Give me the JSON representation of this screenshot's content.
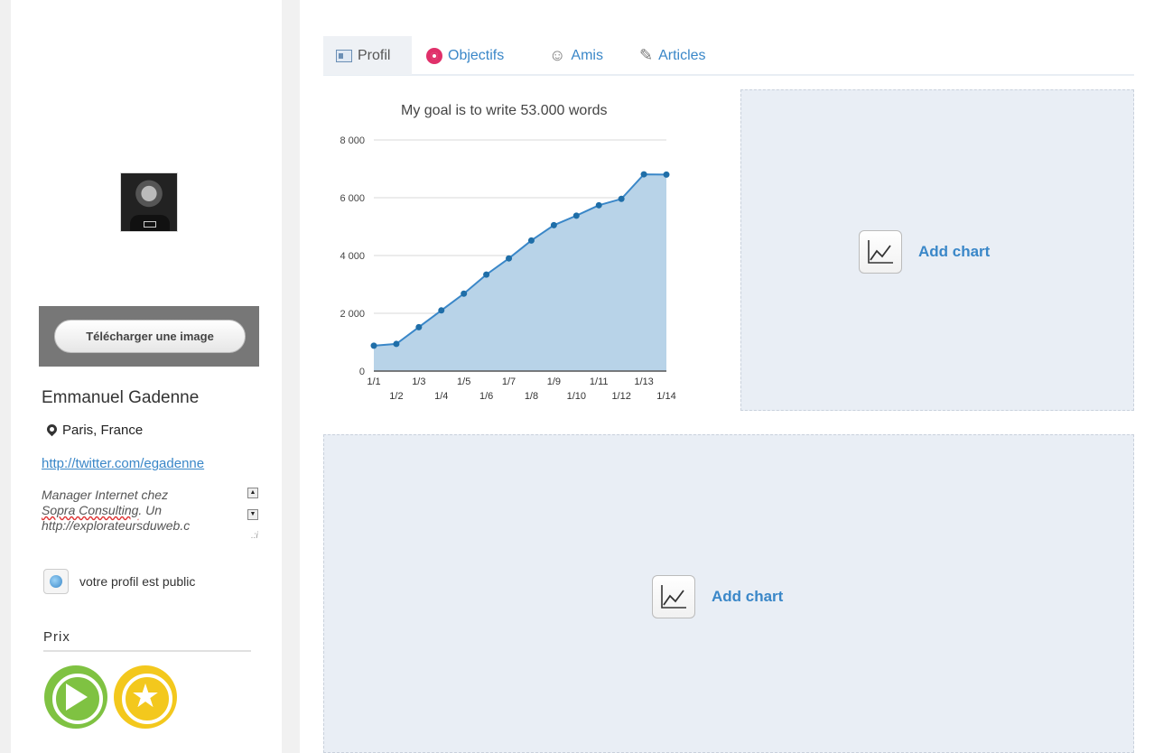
{
  "profile": {
    "upload_label": "Télécharger une image",
    "name": "Emmanuel Gadenne",
    "location": "Paris, France",
    "link": "http://twitter.com/egadenne",
    "bio": {
      "line1": "Manager Internet chez",
      "misspelled": "Sopra Consulting",
      "line2_rest": ". Un",
      "line3": "http://explorateursduweb.c"
    },
    "visibility": "votre profil est public",
    "awards_title": "Prix"
  },
  "tabs": [
    {
      "label": "Profil",
      "icon": "id-card-icon"
    },
    {
      "label": "Objectifs",
      "icon": "target-icon"
    },
    {
      "label": "Amis",
      "icon": "people-icon"
    },
    {
      "label": "Articles",
      "icon": "pencil-icon"
    }
  ],
  "add_chart_label": "Add chart",
  "colors": {
    "accent": "#3a87c8",
    "area_fill": "#b8d3e8",
    "line": "#3a87c8",
    "panel": "#e9eef5",
    "badge_green": "#7fc242",
    "badge_yellow": "#f3c81d"
  },
  "chart_data": {
    "type": "area",
    "title": "My goal is to write 53.000 words",
    "x": [
      "1/1",
      "1/2",
      "1/3",
      "1/4",
      "1/5",
      "1/6",
      "1/7",
      "1/8",
      "1/9",
      "1/10",
      "1/11",
      "1/12",
      "1/13",
      "1/14"
    ],
    "values": [
      880,
      940,
      1520,
      2100,
      2680,
      3340,
      3900,
      4520,
      5050,
      5380,
      5740,
      5960,
      6810,
      6800
    ],
    "ylim": [
      0,
      8000
    ],
    "yticks": [
      0,
      2000,
      4000,
      6000,
      8000
    ],
    "ytick_labels": [
      "0",
      "2 000",
      "4 000",
      "6 000",
      "8 000"
    ],
    "grid": true,
    "legend": false
  }
}
